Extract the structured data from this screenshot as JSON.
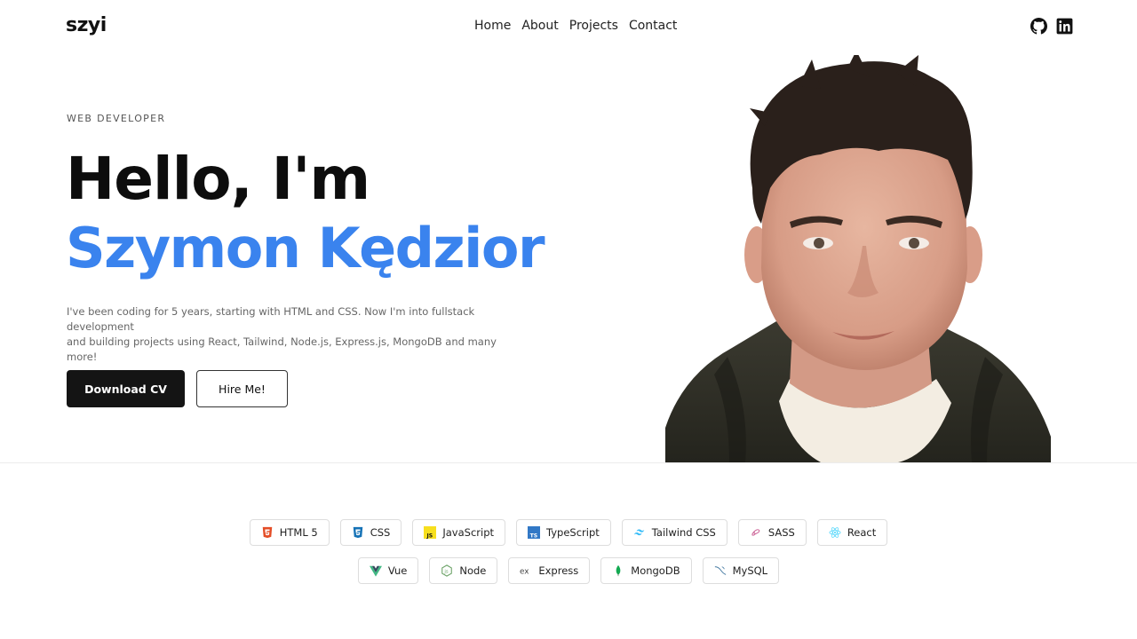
{
  "nav": {
    "logo": "szyi",
    "links": [
      "Home",
      "About",
      "Projects",
      "Contact"
    ],
    "social_icons": [
      "github-icon",
      "linkedin-icon"
    ]
  },
  "hero": {
    "eyebrow": "WEB DEVELOPER",
    "greeting": "Hello, I'm",
    "name": "Szymon Kędzior",
    "intro_line1": "I've been coding for 5 years, starting with HTML and CSS. Now I'm into fullstack development",
    "intro_line2": "and building projects using React, Tailwind, Node.js, Express.js, MongoDB and many more!",
    "primary_button": "Download CV",
    "secondary_button": "Hire Me!",
    "accent_color": "#3a83ee"
  },
  "skills": {
    "row1": [
      {
        "label": "HTML 5",
        "icon": "html5-icon",
        "color": "#e44d26"
      },
      {
        "label": "CSS",
        "icon": "css3-icon",
        "color": "#1572b6"
      },
      {
        "label": "JavaScript",
        "icon": "javascript-icon",
        "color": "#f7df1e"
      },
      {
        "label": "TypeScript",
        "icon": "typescript-icon",
        "color": "#3178c6"
      },
      {
        "label": "Tailwind CSS",
        "icon": "tailwind-icon",
        "color": "#38bdf8"
      },
      {
        "label": "SASS",
        "icon": "sass-icon",
        "color": "#cd6799"
      },
      {
        "label": "React",
        "icon": "react-icon",
        "color": "#61dafb"
      }
    ],
    "row2": [
      {
        "label": "Vue",
        "icon": "vue-icon",
        "color": "#41b883"
      },
      {
        "label": "Node",
        "icon": "node-icon",
        "color": "#68a063"
      },
      {
        "label": "Express",
        "icon": "express-icon",
        "color": "#444444"
      },
      {
        "label": "MongoDB",
        "icon": "mongodb-icon",
        "color": "#13aa52"
      },
      {
        "label": "MySQL",
        "icon": "mysql-icon",
        "color": "#4479a1"
      }
    ]
  }
}
